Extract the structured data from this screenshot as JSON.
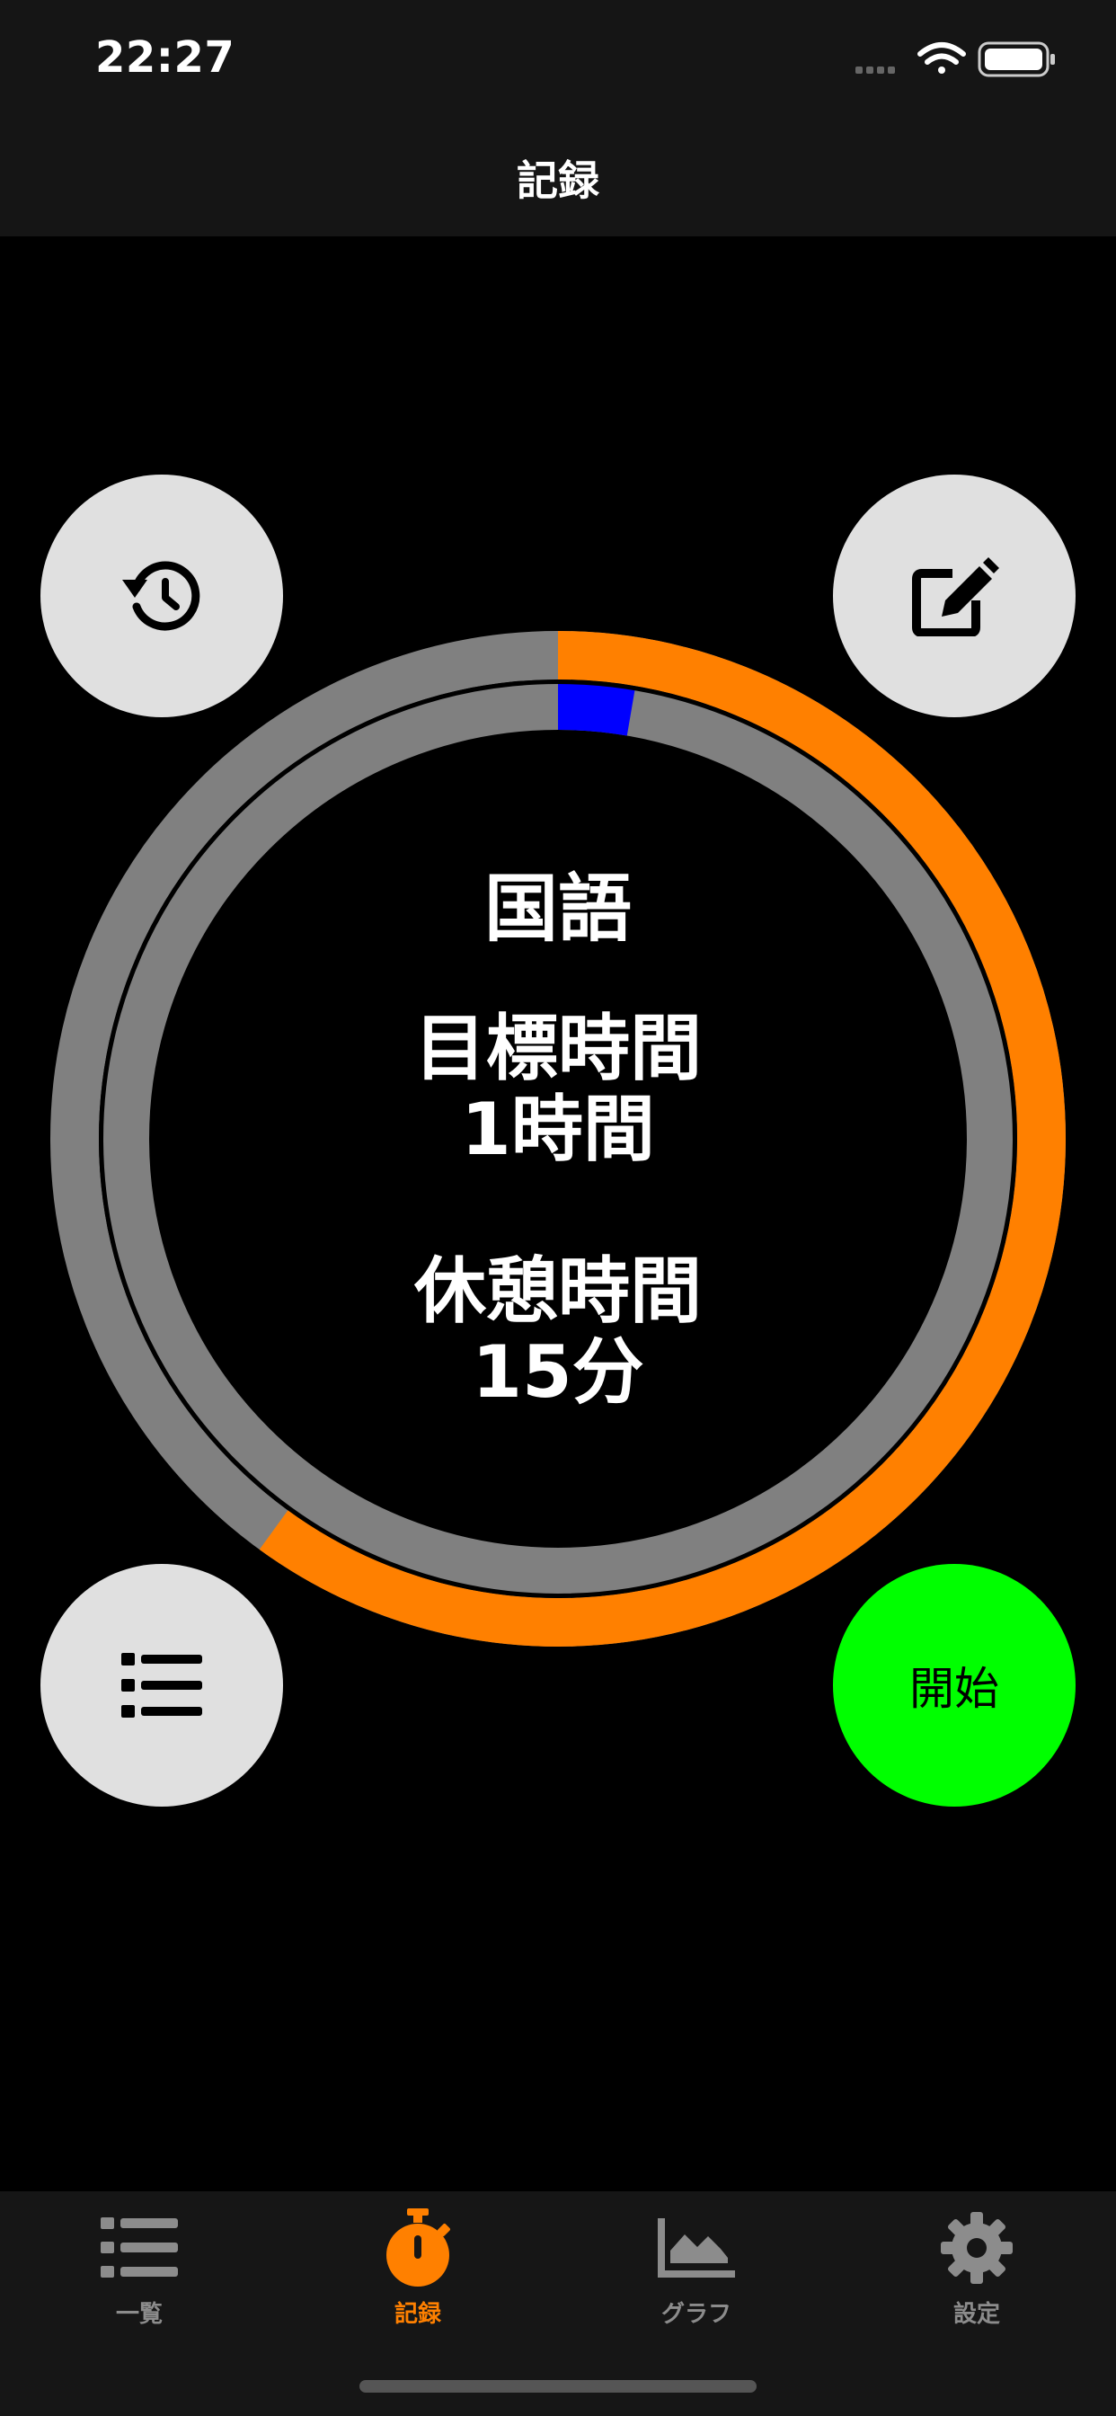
{
  "status_bar": {
    "time": "22:27"
  },
  "header": {
    "title": "記録"
  },
  "timer": {
    "subject": "国語",
    "goal_label": "目標時間",
    "goal_value": "1時間",
    "break_label": "休憩時間",
    "break_value": "15分",
    "outer_progress_fraction": 0.6,
    "inner_progress_fraction": 0.027
  },
  "buttons": {
    "start_label": "開始"
  },
  "tabs": [
    {
      "label": "一覧",
      "active": false,
      "icon": "list-icon"
    },
    {
      "label": "記録",
      "active": true,
      "icon": "stopwatch-icon"
    },
    {
      "label": "グラフ",
      "active": false,
      "icon": "area-chart-icon"
    },
    {
      "label": "設定",
      "active": false,
      "icon": "gear-icon"
    }
  ],
  "colors": {
    "accent": "#ff8000",
    "start_button": "#00ff00",
    "ring_track": "#808080",
    "inner_progress": "#0000ff",
    "button_bg": "#e0e0e0"
  }
}
